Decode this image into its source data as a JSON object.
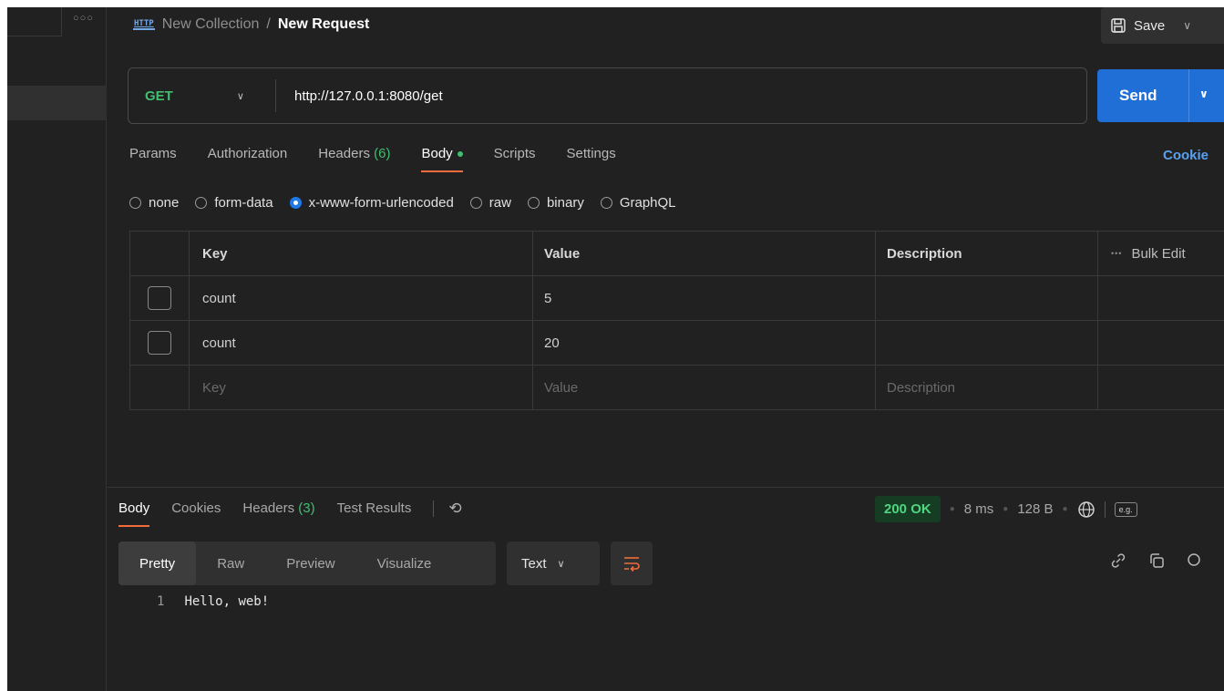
{
  "breadcrumb": {
    "collection": "New Collection",
    "separator": "/",
    "request": "New Request"
  },
  "toolbar": {
    "save_label": "Save"
  },
  "request": {
    "method": "GET",
    "url": "http://127.0.0.1:8080/get",
    "send_label": "Send"
  },
  "tabs": {
    "params": "Params",
    "authorization": "Authorization",
    "headers": "Headers",
    "headers_count": "(6)",
    "body": "Body",
    "scripts": "Scripts",
    "settings": "Settings",
    "cookies": "Cookie"
  },
  "body_types": [
    "none",
    "form-data",
    "x-www-form-urlencoded",
    "raw",
    "binary",
    "GraphQL"
  ],
  "body_type_selected": "x-www-form-urlencoded",
  "table": {
    "headers": {
      "key": "Key",
      "value": "Value",
      "description": "Description",
      "bulk_edit": "Bulk Edit"
    },
    "rows": [
      {
        "key": "count",
        "value": "5",
        "description": ""
      },
      {
        "key": "count",
        "value": "20",
        "description": ""
      }
    ],
    "placeholder": {
      "key": "Key",
      "value": "Value",
      "description": "Description"
    }
  },
  "response": {
    "tabs": {
      "body": "Body",
      "cookies": "Cookies",
      "headers": "Headers",
      "headers_count": "(3)",
      "test_results": "Test Results"
    },
    "status": "200 OK",
    "time": "8 ms",
    "size": "128 B",
    "eg_label": "e.g.",
    "format_tabs": [
      "Pretty",
      "Raw",
      "Preview",
      "Visualize"
    ],
    "format_selected": "Pretty",
    "language": "Text",
    "lines": [
      {
        "number": "1",
        "text": "Hello, web!"
      }
    ]
  },
  "colors": {
    "accent": "#f26b3a",
    "send": "#1f6fd6",
    "method_get": "#3fbf6f",
    "status_ok": "#4fd67f"
  }
}
